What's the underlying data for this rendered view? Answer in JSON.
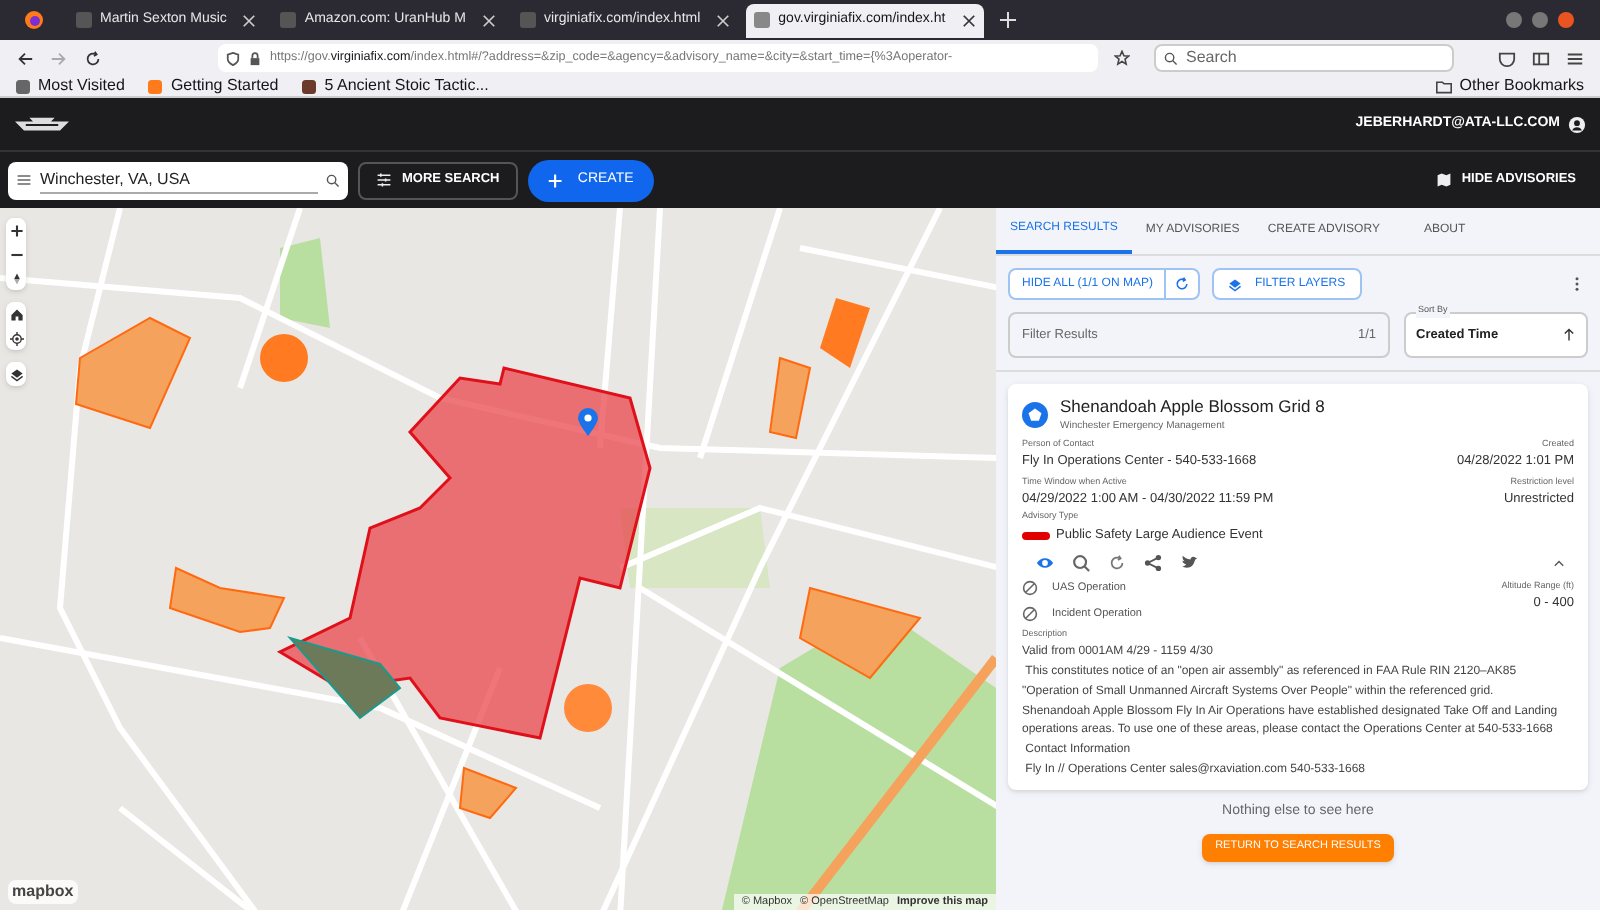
{
  "browser": {
    "tabs": [
      {
        "title": "Martin Sexton Music",
        "selected": false
      },
      {
        "title": "Amazon.com: UranHub M",
        "selected": false
      },
      {
        "title": "virginiafix.com/index.html",
        "selected": false
      },
      {
        "title": "gov.virginiafix.com/index.ht",
        "selected": true
      }
    ],
    "url_prefix": "https://gov.",
    "url_domain": "virginiafix.com",
    "url_rest": "/index.html#/?address=&zip_code=&agency=&advisory_name=&city=&start_time={%3Aoperator-",
    "search_placeholder": "Search",
    "bookmarks": [
      "Most Visited",
      "Getting Started",
      "5 Ancient Stoic Tactic..."
    ],
    "other_bookmarks": "Other Bookmarks"
  },
  "header": {
    "user": "JEBERHARDT@ATA-LLC.COM"
  },
  "toolbar": {
    "search_value": "Winchester, VA, USA",
    "more_search": "MORE SEARCH",
    "create": "CREATE",
    "hide_advisories": "HIDE ADVISORIES"
  },
  "map": {
    "attribution": [
      "© Mapbox",
      "© OpenStreetMap"
    ],
    "improve_link": "Improve this map",
    "logo": "mapbox"
  },
  "panel": {
    "tabs": [
      {
        "label": "SEARCH RESULTS",
        "selected": true
      },
      {
        "label": "MY ADVISORIES",
        "selected": false
      },
      {
        "label": "CREATE ADVISORY",
        "selected": false
      },
      {
        "label": "ABOUT",
        "selected": false
      }
    ],
    "hide_all": "HIDE ALL (1/1 ON MAP)",
    "filter_layers": "FILTER LAYERS",
    "filter": {
      "placeholder": "Filter Results",
      "count": "1/1"
    },
    "sort": {
      "label": "Sort By",
      "value": "Created Time"
    },
    "card": {
      "title": "Shenandoah Apple Blossom Grid 8",
      "agency": "Winchester Emergency Management",
      "fields": [
        {
          "label": "Person of Contact",
          "value": "Fly In Operations Center - 540-533-1668",
          "right_label": "Created",
          "right_value": "04/28/2022 1:01 PM"
        },
        {
          "label": "Time Window when Active",
          "value": "04/29/2022 1:00 AM - 04/30/2022 11:59 PM",
          "right_label": "Restriction level",
          "right_value": "Unrestricted"
        }
      ],
      "advisory_type_label": "Advisory Type",
      "advisory_type": "Public Safety Large Audience Event",
      "operations": [
        "UAS Operation",
        "Incident Operation"
      ],
      "altitude_label": "Altitude Range (ft)",
      "altitude": "0 - 400",
      "description_label": "Description",
      "description": [
        "Valid from 0001AM 4/29 - 1159 4/30",
        " This constitutes notice of an \"open air assembly\" as referenced in FAA Rule RIN 2120–AK85",
        "\"Operation of Small Unmanned Aircraft Systems Over People\" within the referenced grid.",
        "Shenandoah Apple Blossom Fly In Air Operations have established designated Take Off and Landing operations areas. To use one of these areas, please contact the Operations Center at 540-533-1668",
        " Contact Information",
        " Fly In // Operations Center sales@rxaviation.com 540-533-1668"
      ]
    },
    "end_text": "Nothing else to see here",
    "return_button": "RETURN TO SEARCH RESULTS"
  }
}
